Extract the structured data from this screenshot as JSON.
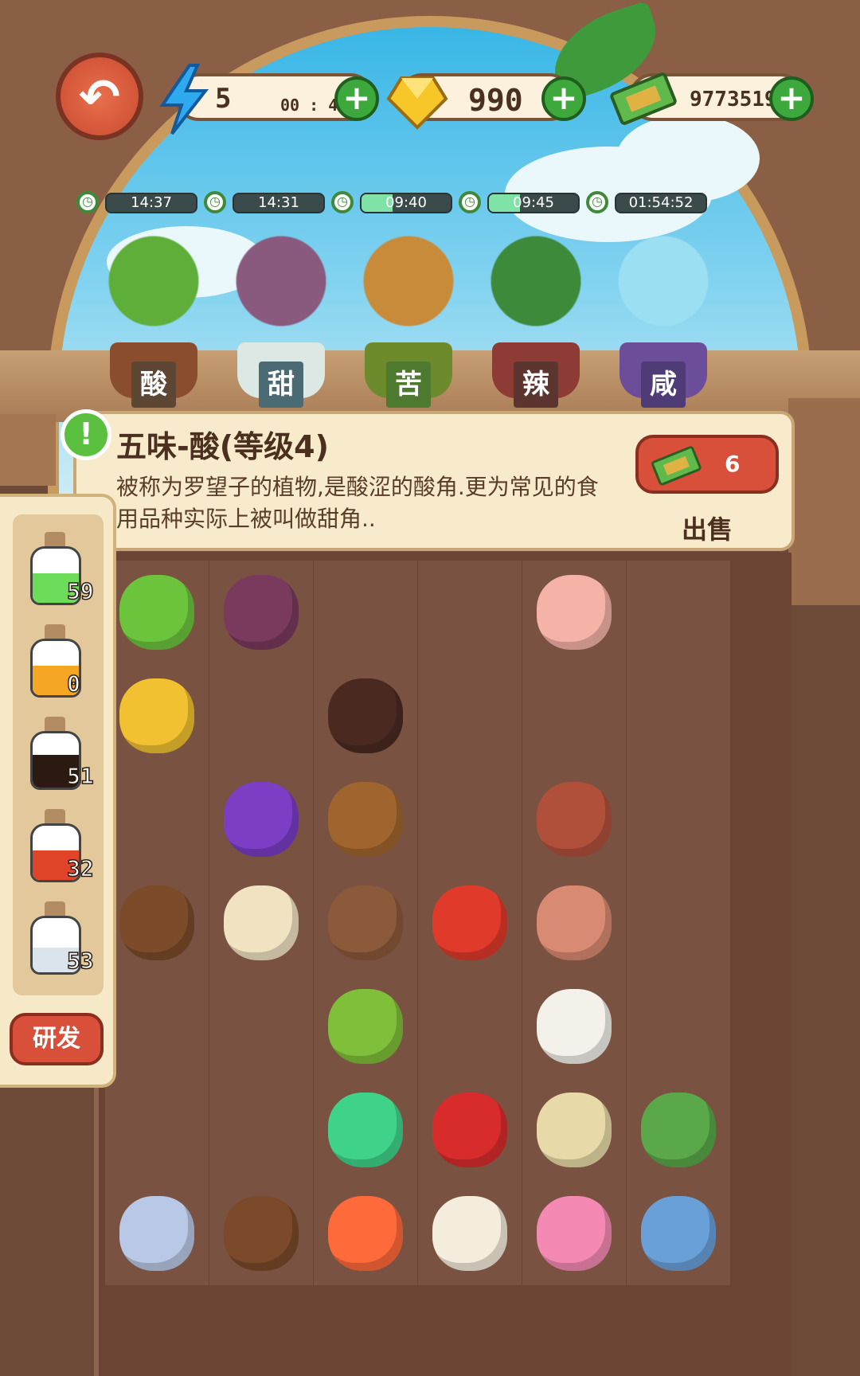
{
  "top_bar": {
    "energy": {
      "value": "5",
      "timer": "00 : 41",
      "icon": "lightning-icon"
    },
    "gems": {
      "value": "990",
      "icon": "gem-icon"
    },
    "cash": {
      "value": "9773519",
      "icon": "cash-icon"
    },
    "plus_label": "+"
  },
  "plants": [
    {
      "timer": "14:37",
      "taste": "酸",
      "progress": 0.0,
      "tag_color": "#5e4634",
      "icon": "lemon-tree-icon"
    },
    {
      "timer": "14:31",
      "taste": "甜",
      "progress": 0.0,
      "tag_color": "#4a6a74",
      "icon": "sugarcane-plant-icon"
    },
    {
      "timer": "09:40",
      "taste": "苦",
      "progress": 0.35,
      "tag_color": "#4d7a2e",
      "icon": "bitter-gourd-tree-icon"
    },
    {
      "timer": "09:45",
      "taste": "辣",
      "progress": 0.35,
      "tag_color": "#5d3530",
      "icon": "chili-plant-icon"
    },
    {
      "timer": "01:54:52",
      "taste": "咸",
      "progress": 0.0,
      "tag_color": "#4f3c76",
      "icon": "salt-crystal-icon"
    }
  ],
  "info_panel": {
    "title": "五味-酸(等级4)",
    "description": "被称为罗望子的植物,是酸涩的酸角.更为常见的食用品种实际上被叫做甜角..",
    "sell_price": "6",
    "sell_label": "出售"
  },
  "side_panel": {
    "bottles": [
      {
        "count": "59",
        "color": "#6ddc5a",
        "level": 0.55,
        "icon": "green-potion-icon"
      },
      {
        "count": "0",
        "color": "#f5a623",
        "level": 0.55,
        "icon": "honey-jar-icon"
      },
      {
        "count": "51",
        "color": "#2b1a12",
        "level": 0.6,
        "icon": "soy-sauce-bottle-icon"
      },
      {
        "count": "32",
        "color": "#e0452a",
        "level": 0.55,
        "icon": "chili-oil-bottle-icon"
      },
      {
        "count": "53",
        "color": "#d9e4ec",
        "level": 0.45,
        "icon": "salt-jar-icon"
      }
    ],
    "research_label": "研发"
  },
  "inventory": {
    "rows": [
      [
        "lime-icon",
        "sugarcane-icon",
        "",
        "",
        "shrimp-bowl-icon",
        ""
      ],
      [
        "lemon-icon",
        "",
        "chocolate-icon",
        "",
        "",
        ""
      ],
      [
        "",
        "candy-icon",
        "coffee-beans-icon",
        "",
        "ham-icon",
        ""
      ],
      [
        "tamarind-icon",
        "cream-puff-icon",
        "spice-bowl-icon",
        "chili-bowl-icon",
        "salted-fish-icon",
        ""
      ],
      [
        "",
        "",
        "tea-leaves-icon",
        "",
        "salted-egg-icon",
        ""
      ],
      [
        "",
        "",
        "lighter-icon",
        "rose-icon",
        "trading-card-icon",
        "recipe-book-icon"
      ],
      [
        "key-icon",
        "walnut-icon",
        "sneaker-icon",
        "folding-fan-icon",
        "hand-mirror-icon",
        "fish-icon"
      ]
    ]
  }
}
